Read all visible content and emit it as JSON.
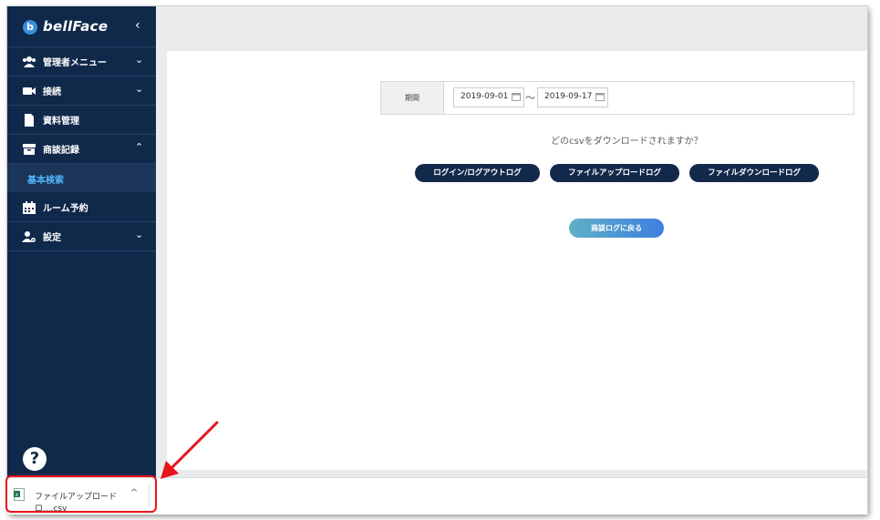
{
  "brand": {
    "badge": "b",
    "name": "bellFace"
  },
  "sidebar": {
    "collapse_glyph": "‹",
    "items": [
      {
        "label": "管理者メニュー",
        "icon": "users-icon",
        "chevron": "⌄"
      },
      {
        "label": "接続",
        "icon": "video-camera-icon",
        "chevron": "⌄"
      },
      {
        "label": "資料管理",
        "icon": "document-icon",
        "chevron": ""
      },
      {
        "label": "商談記録",
        "icon": "archive-box-icon",
        "chevron": "⌃"
      },
      {
        "label": "ルーム予約",
        "icon": "calendar-icon",
        "chevron": ""
      },
      {
        "label": "設定",
        "icon": "user-cog-icon",
        "chevron": "⌄"
      }
    ],
    "sub_item": {
      "label": "基本検索"
    },
    "help_glyph": "?"
  },
  "filter": {
    "label": "期間",
    "start_date": "2019-09-01",
    "end_date": "2019-09-17",
    "separator": "〜"
  },
  "prompt": "どのcsvをダウンロードされますか？",
  "buttons": {
    "login_log": "ログイン/ログアウトログ",
    "upload_log": "ファイルアップロードログ",
    "download_log": "ファイルダウンロードログ",
    "back": "商談ログに戻る"
  },
  "download_shelf": {
    "file_name": "ファイルアップロードロ....csv",
    "chevron": "^"
  },
  "colors": {
    "sidebar": "#10294b",
    "accent": "#53b6ff",
    "pill": "#13294b",
    "highlight": "#e8141b"
  }
}
